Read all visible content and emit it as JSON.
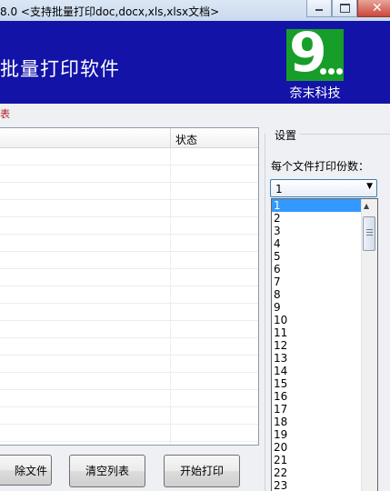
{
  "window": {
    "title": "8.0  <支持批量打印doc,docx,xls,xlsx文档>",
    "min_label": "–",
    "max_label": "□",
    "close_label": "✕"
  },
  "banner": {
    "title": "批量打印软件",
    "logo_glyph": "9",
    "logo_text": "奈末科技",
    "background": "#1313a8",
    "logo_green": "#179e2a"
  },
  "filelist": {
    "caption": "表",
    "columns": [
      "",
      "状态"
    ]
  },
  "buttons": {
    "remove": "除文件",
    "clear": "清空列表",
    "print": "开始打印"
  },
  "settings": {
    "group_label": "设置",
    "copies_label": "每个文件打印份数：",
    "copies_value": "1",
    "options": [
      "1",
      "2",
      "3",
      "4",
      "5",
      "6",
      "7",
      "8",
      "9",
      "10",
      "11",
      "12",
      "13",
      "14",
      "15",
      "16",
      "17",
      "18",
      "19",
      "20",
      "21",
      "22",
      "23"
    ]
  }
}
